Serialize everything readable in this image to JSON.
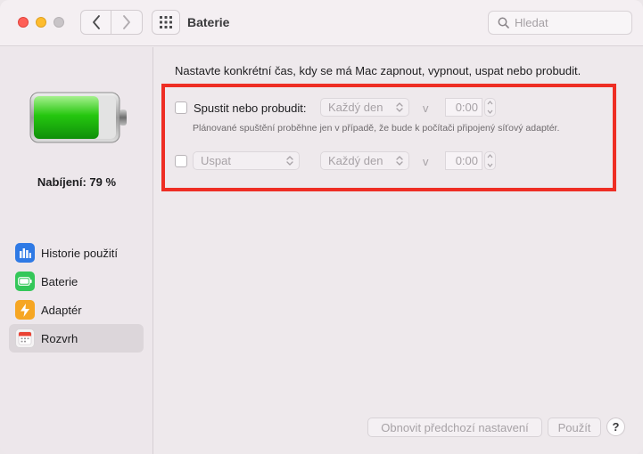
{
  "window": {
    "title": "Baterie"
  },
  "search": {
    "placeholder": "Hledat"
  },
  "sidebar": {
    "charge_label": "Nabíjení: 79 %",
    "charge_level": 0.79,
    "items": [
      {
        "label": "Historie použití",
        "icon": "bar-chart-icon",
        "selected": false
      },
      {
        "label": "Baterie",
        "icon": "battery-icon",
        "selected": false
      },
      {
        "label": "Adaptér",
        "icon": "lightning-icon",
        "selected": false
      },
      {
        "label": "Rozvrh",
        "icon": "calendar-icon",
        "selected": true
      }
    ]
  },
  "main": {
    "intro": "Nastavte konkrétní čas, kdy se má Mac zapnout, vypnout, uspat nebo probudit.",
    "row1": {
      "label": "Spustit nebo probudit:",
      "frequency": "Každý den",
      "v": "v",
      "time": "0:00",
      "checked": false
    },
    "note": "Plánované spuštění proběhne jen v případě, že bude k počítači připojený síťový adaptér.",
    "row2": {
      "action": "Uspat",
      "frequency": "Každý den",
      "v": "v",
      "time": "0:00",
      "checked": false
    },
    "restore_button": "Obnovit předchozí nastavení",
    "apply_button": "Použít",
    "help": "?"
  },
  "colors": {
    "highlight": "#ee2e24",
    "battery_green": "#34c759"
  }
}
